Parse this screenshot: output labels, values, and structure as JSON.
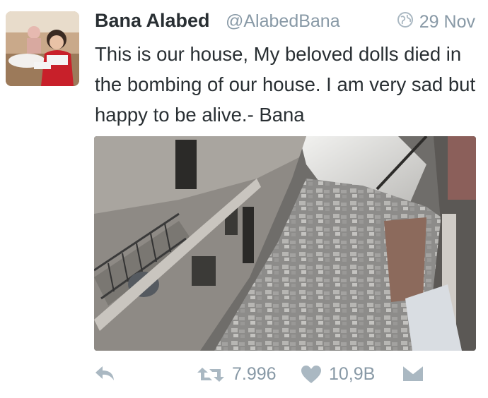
{
  "tweet": {
    "author_name": "Bana Alabed",
    "handle": "@AlabedBana",
    "date": "29 Nov",
    "text": "This is our house, My beloved dolls died in the bombing of our house. I am very sad but happy to be alive.- Bana"
  },
  "actions": {
    "retweet_count": "7.996",
    "like_count": "10,9B"
  },
  "colors": {
    "text": "#292f33",
    "muted": "#8899a6",
    "background": "#ffffff"
  },
  "icons": [
    "globe-icon",
    "reply-icon",
    "retweet-icon",
    "heart-icon",
    "message-icon"
  ]
}
